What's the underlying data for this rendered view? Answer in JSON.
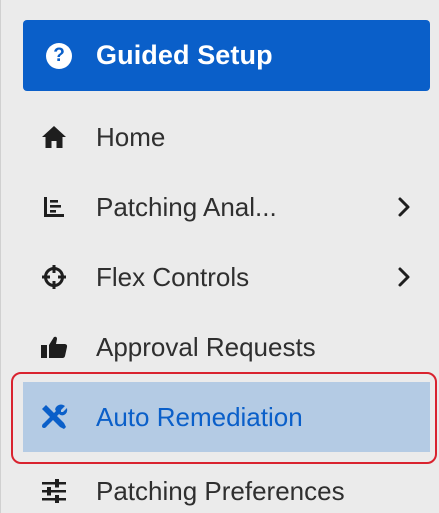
{
  "nav": {
    "guided_setup": {
      "label": "Guided Setup",
      "icon": "question-circle-icon"
    },
    "items": [
      {
        "label": "Home",
        "icon": "home-icon",
        "has_submenu": false
      },
      {
        "label": "Patching Anal...",
        "icon": "chart-icon",
        "has_submenu": true
      },
      {
        "label": "Flex Controls",
        "icon": "crosshair-icon",
        "has_submenu": true
      },
      {
        "label": "Approval Requests",
        "icon": "thumbs-up-icon",
        "has_submenu": false
      },
      {
        "label": "Auto Remediation",
        "icon": "tools-icon",
        "has_submenu": false,
        "active": true
      },
      {
        "label": "Patching Preferences",
        "icon": "sliders-icon",
        "has_submenu": false
      }
    ]
  },
  "colors": {
    "primary": "#0a5fc9",
    "active_bg": "#b4cbe4",
    "highlight_border": "#d9232f",
    "panel_bg": "#ebebeb"
  }
}
